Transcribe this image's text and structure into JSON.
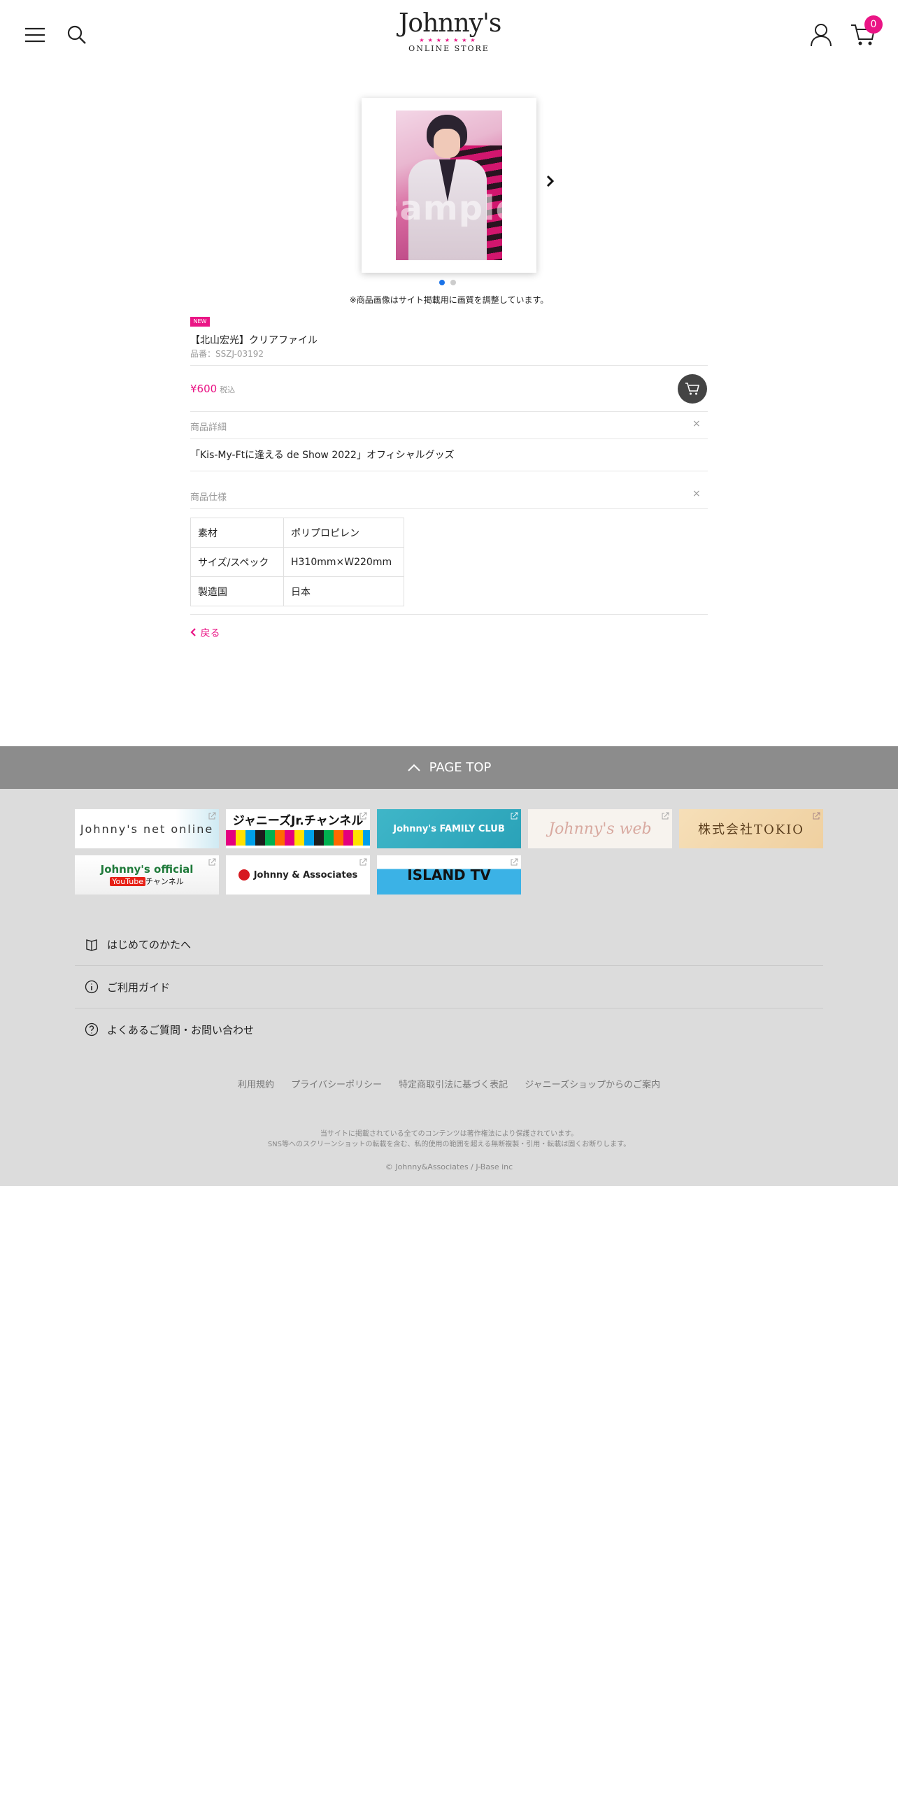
{
  "header": {
    "logo_main": "Johnny's",
    "logo_stars": "★★★★★★★",
    "logo_sub": "ONLINE STORE",
    "cart_count": "0"
  },
  "product": {
    "watermark": "sample",
    "image_note": "※商品画像はサイト掲載用に画質を調整しています。",
    "badge": "NEW",
    "title": "【北山宏光】クリアファイル",
    "sku": "品番：SSZJ-03192",
    "price": "¥600",
    "tax": "税込",
    "detail_heading": "商品詳細",
    "description": "「Kis-My-Ftに逢える de Show 2022」オフィシャルグッズ",
    "spec_heading": "商品仕様",
    "specs": [
      {
        "key": "素材",
        "value": "ポリプロピレン"
      },
      {
        "key": "サイズ/スペック",
        "value": "H310mm×W220mm"
      },
      {
        "key": "製造国",
        "value": "日本"
      }
    ],
    "back": "戻る"
  },
  "pagetop": "PAGE TOP",
  "banners": {
    "netonline": "Johnny's net online",
    "jrch": "ジャニーズJr.チャンネル",
    "family": "Johnny's FAMILY CLUB",
    "jweb": "Johnny's web",
    "tokio": "株式会社TOKIO",
    "official_1": "Johnny's official",
    "official_yt": "YouTube",
    "official_2": "チャンネル",
    "associates": "Johnny & Associates",
    "island": "ISLAND TV"
  },
  "footer": {
    "links": [
      "はじめてのかたへ",
      "ご利用ガイド",
      "よくあるご質問・お問い合わせ"
    ],
    "legal": [
      "利用規約",
      "プライバシーポリシー",
      "特定商取引法に基づく表記",
      "ジャニーズショップからのご案内"
    ],
    "copyright_note_1": "当サイトに掲載されている全てのコンテンツは著作権法により保護されています。",
    "copyright_note_2": "SNS等へのスクリーンショットの転載を含む、私的使用の範囲を超える無断複製・引用・転載は固くお断りします。",
    "copyright": "© Johnny&Associates / J-Base inc"
  },
  "colors": {
    "accent": "#ea1485",
    "pagetop_bg": "#8c8c8c",
    "footer_bg": "#dcdcdc"
  }
}
